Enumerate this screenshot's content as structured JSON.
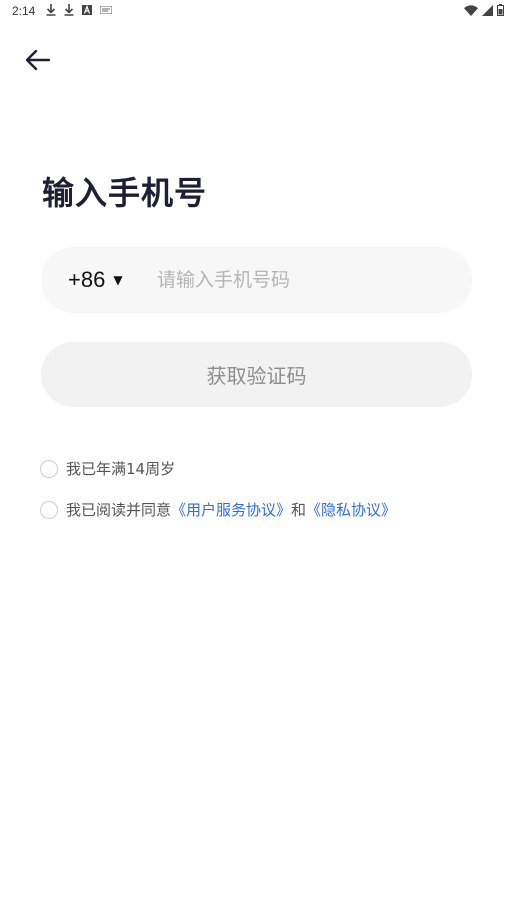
{
  "status_bar": {
    "time": "2:14",
    "left_icons": [
      "download-icon",
      "download-icon",
      "app-a-icon",
      "app-badge-icon"
    ],
    "right_icons": [
      "wifi-icon",
      "signal-icon",
      "battery-icon"
    ]
  },
  "header": {
    "back_icon": "arrow-left-icon"
  },
  "title": "输入手机号",
  "phone": {
    "country_code": "+86",
    "caret": "▼",
    "placeholder": "请输入手机号码",
    "value": ""
  },
  "get_code_button": {
    "label": "获取验证码"
  },
  "age_check": {
    "label": "我已年满14周岁",
    "checked": false
  },
  "agreement_check": {
    "prefix": "我已阅读并同意",
    "terms_link": "《用户服务协议》",
    "conjunction": "和",
    "privacy_link": "《隐私协议》",
    "checked": false
  },
  "colors": {
    "title": "#1d1f33",
    "field_bg": "#f7f7f7",
    "button_bg": "#f2f2f2",
    "button_text": "#8e8e8e",
    "link": "#2f6fd6"
  }
}
